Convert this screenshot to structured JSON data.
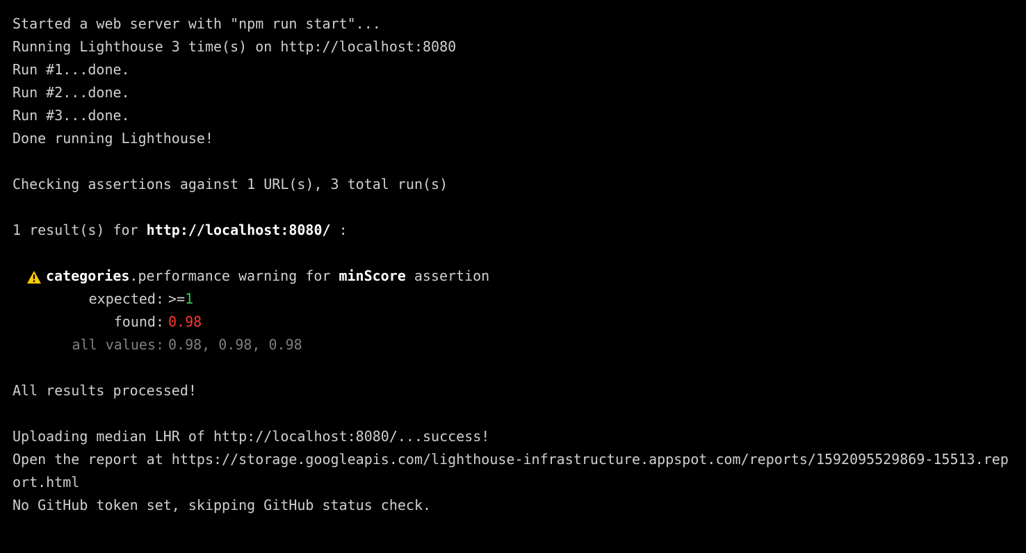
{
  "lines": {
    "started": "Started a web server with \"npm run start\"...",
    "running": "Running Lighthouse 3 time(s) on http://localhost:8080",
    "run1": "Run #1...done.",
    "run2": "Run #2...done.",
    "run3": "Run #3...done.",
    "doneRunning": "Done running Lighthouse!",
    "checking": "Checking assertions against 1 URL(s), 3 total run(s)",
    "resultsPrefix": "1 result(s) for ",
    "resultsUrl": "http://localhost:8080/",
    "resultsSuffix": " :",
    "allProcessed": "All results processed!",
    "uploading": "Uploading median LHR of http://localhost:8080/...success!",
    "openReport": "Open the report at https://storage.googleapis.com/lighthouse-infrastructure.appspot.com/reports/1592095529869-15513.report.html",
    "noToken": "No GitHub token set, skipping GitHub status check."
  },
  "assertion": {
    "category": "categories",
    "dot": ".",
    "middle": "performance warning for ",
    "metric": "minScore",
    "suffix": " assertion",
    "expectedLabel": "expected:",
    "expectedOp": ">=",
    "expectedVal": "1",
    "foundLabel": "found:",
    "foundVal": "0.98",
    "allValuesLabel": "all values:",
    "allValuesVal": "0.98, 0.98, 0.98"
  }
}
